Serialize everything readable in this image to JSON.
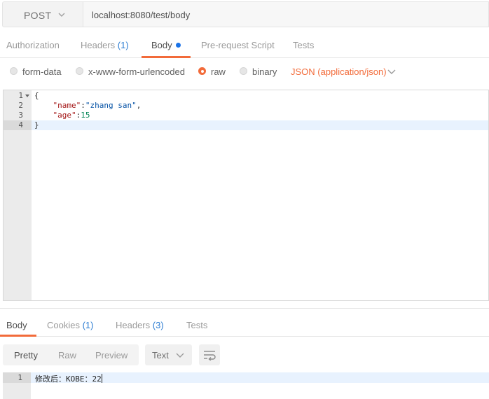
{
  "request": {
    "method": "POST",
    "url": "localhost:8080/test/body"
  },
  "request_tabs": [
    {
      "label": "Authorization",
      "count": ""
    },
    {
      "label": "Headers",
      "count": "(1)"
    },
    {
      "label": "Body",
      "count": ""
    },
    {
      "label": "Pre-request Script",
      "count": ""
    },
    {
      "label": "Tests",
      "count": ""
    }
  ],
  "active_request_tab": "Body",
  "body_types": {
    "options": [
      "form-data",
      "x-www-form-urlencoded",
      "raw",
      "binary"
    ],
    "selected": "raw",
    "content_type": "JSON (application/json)"
  },
  "editor": {
    "line_numbers": [
      "1",
      "2",
      "3",
      "4"
    ],
    "lines": {
      "l1": "{",
      "l2_key": "\"name\"",
      "l2_sep": ":",
      "l2_val": "\"zhang san\"",
      "l2_end": ",",
      "l3_key": "\"age\"",
      "l3_sep": ":",
      "l3_val": "15",
      "l4": "}"
    },
    "active_line": 4
  },
  "response_tabs": [
    {
      "label": "Body",
      "count": ""
    },
    {
      "label": "Cookies",
      "count": "(1)"
    },
    {
      "label": "Headers",
      "count": "(3)"
    },
    {
      "label": "Tests",
      "count": ""
    }
  ],
  "active_response_tab": "Body",
  "response_toolbar": {
    "views": [
      "Pretty",
      "Raw",
      "Preview"
    ],
    "active_view": "Pretty",
    "format": "Text",
    "wrap_icon": "wrap-lines-icon"
  },
  "response": {
    "line_number": "1",
    "text": "修改后：KOBE：22"
  },
  "colors": {
    "accent": "#f26b3a",
    "count": "#2d7dd2",
    "unsaved_dot": "#1a73e8"
  }
}
